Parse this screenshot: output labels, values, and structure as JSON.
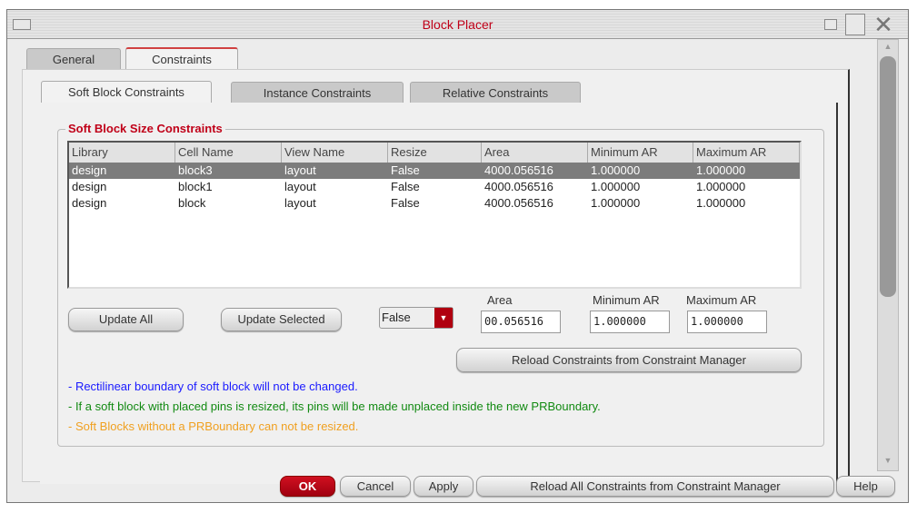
{
  "window": {
    "title": "Block Placer"
  },
  "tabs": [
    {
      "label": "General"
    },
    {
      "label": "Constraints"
    }
  ],
  "subtabs": [
    {
      "label": "Soft Block Constraints"
    },
    {
      "label": "Instance Constraints"
    },
    {
      "label": "Relative Constraints"
    }
  ],
  "group": {
    "title": "Soft Block Size Constraints"
  },
  "table": {
    "columns": [
      "Library",
      "Cell Name",
      "View Name",
      "Resize",
      "Area",
      "Minimum AR",
      "Maximum AR"
    ],
    "rows": [
      [
        "design",
        "block3",
        "layout",
        "False",
        "4000.056516",
        "1.000000",
        "1.000000"
      ],
      [
        "design",
        "block1",
        "layout",
        "False",
        "4000.056516",
        "1.000000",
        "1.000000"
      ],
      [
        "design",
        "block",
        "layout",
        "False",
        "4000.056516",
        "1.000000",
        "1.000000"
      ]
    ]
  },
  "controls": {
    "update_all": "Update All",
    "update_selected": "Update Selected",
    "resize_value": "False",
    "area_label": "Area",
    "area_value": "00.056516",
    "min_ar_label": "Minimum AR",
    "min_ar_value": "1.000000",
    "max_ar_label": "Maximum AR",
    "max_ar_value": "1.000000",
    "reload": "Reload Constraints from Constraint Manager"
  },
  "notes": [
    {
      "text": "- Rectilinear boundary of soft block will not be changed.",
      "color": "#1a1aff"
    },
    {
      "text": "- If a soft block with placed pins is resized, its pins will be made unplaced inside the new PRBoundary.",
      "color": "#128a12"
    },
    {
      "text": "- Soft Blocks without a PRBoundary can not be resized.",
      "color": "#f0a020"
    }
  ],
  "footer": {
    "ok": "OK",
    "cancel": "Cancel",
    "apply": "Apply",
    "reload_all": "Reload All Constraints from Constraint Manager",
    "help": "Help"
  }
}
